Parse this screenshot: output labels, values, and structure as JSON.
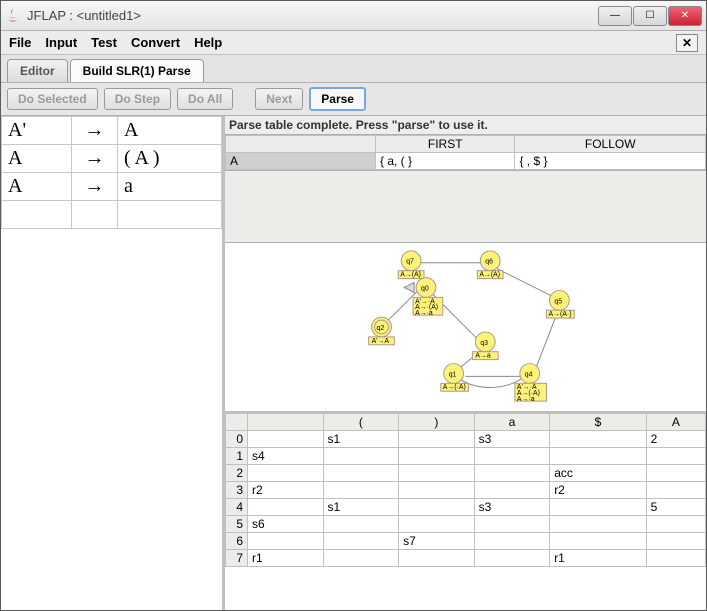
{
  "title": "JFLAP : <untitled1>",
  "menubar": {
    "items": [
      "File",
      "Input",
      "Test",
      "Convert",
      "Help"
    ]
  },
  "tabs": [
    {
      "label": "Editor",
      "active": false
    },
    {
      "label": "Build SLR(1) Parse",
      "active": true
    }
  ],
  "toolbar": {
    "do_selected": "Do Selected",
    "do_step": "Do Step",
    "do_all": "Do All",
    "next": "Next",
    "parse": "Parse"
  },
  "grammar": [
    {
      "lhs": "A'",
      "rhs": "A"
    },
    {
      "lhs": "A",
      "rhs": "( A )"
    },
    {
      "lhs": "A",
      "rhs": "a"
    },
    {
      "lhs": "",
      "rhs": ""
    }
  ],
  "status_text": "Parse table complete.  Press \"parse\" to use it.",
  "first_follow": {
    "headers": {
      "first": "FIRST",
      "follow": "FOLLOW"
    },
    "row": {
      "nonterm": "A",
      "first": "{ a, ( }",
      "follow": "{ , $ }"
    }
  },
  "graph": {
    "states": [
      "q0",
      "q1",
      "q2",
      "q3",
      "q4",
      "q5",
      "q6",
      "q7"
    ],
    "labels": {
      "q0": "A'→·A\nA→·(A)\nA→·a",
      "q1": "A→(·A)",
      "q2": "A'→A·",
      "q3": "A→a·",
      "q4": "A'→·A\nA→(·A)\nA→·a",
      "q5": "A→(A·)",
      "q6": "A→(A)·",
      "q7": "A→(A)·"
    }
  },
  "parse_table": {
    "columns": [
      "",
      "(",
      ")",
      "a",
      "$",
      "A"
    ],
    "rows": [
      {
        "state": "0",
        "cells": [
          "",
          "s1",
          "",
          "s3",
          "",
          "2"
        ]
      },
      {
        "state": "1",
        "cells": [
          "s4",
          "",
          "",
          "",
          "",
          ""
        ]
      },
      {
        "state": "2",
        "cells": [
          "",
          "",
          "",
          "",
          "acc",
          ""
        ]
      },
      {
        "state": "3",
        "cells": [
          "r2",
          "",
          "",
          "",
          "r2",
          ""
        ]
      },
      {
        "state": "4",
        "cells": [
          "",
          "s1",
          "",
          "s3",
          "",
          "5"
        ]
      },
      {
        "state": "5",
        "cells": [
          "s6",
          "",
          "",
          "",
          "",
          ""
        ]
      },
      {
        "state": "6",
        "cells": [
          "",
          "",
          "s7",
          "",
          "",
          ""
        ]
      },
      {
        "state": "7",
        "cells": [
          "r1",
          "",
          "",
          "",
          "r1",
          ""
        ]
      }
    ]
  }
}
